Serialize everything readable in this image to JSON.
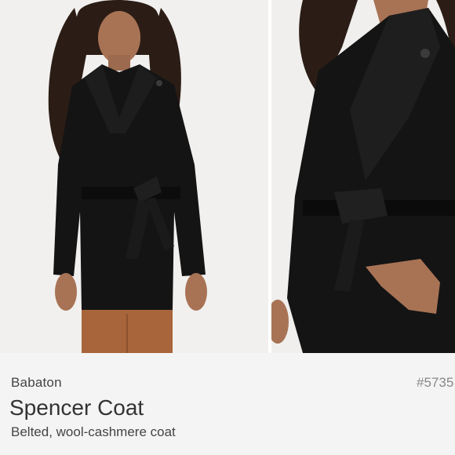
{
  "listing": {
    "brand": "Babaton",
    "sku": "#5735",
    "title": "Spencer Coat",
    "subtitle": "Belted, wool-cashmere coat"
  },
  "images": [
    {
      "name": "product-photo-full-view"
    },
    {
      "name": "product-photo-closeup"
    }
  ],
  "colors": {
    "background": "#f4f4f4",
    "coat": "#141414",
    "pants": "#a8643a"
  }
}
